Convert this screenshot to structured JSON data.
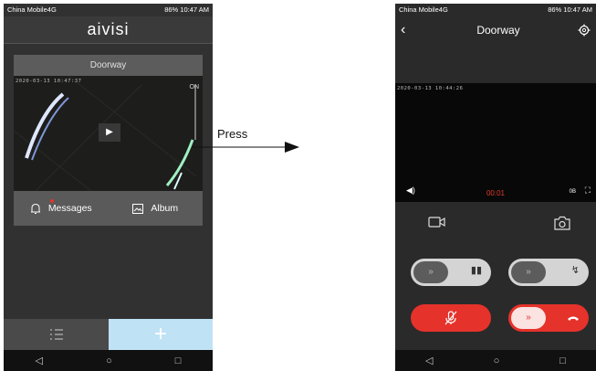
{
  "left_phone": {
    "statusbar": {
      "carrier": "China Mobile4G",
      "battery": "86%",
      "time": "10:47 AM"
    },
    "app_logo": "aivisi",
    "camera": {
      "name": "Doorway",
      "timestamp": "2020-03-13 10:47:37",
      "state": "ON"
    },
    "actions": {
      "messages": "Messages",
      "album": "Album"
    },
    "bottom_tabs": {
      "add_symbol": "+"
    }
  },
  "annotation": {
    "press": "Press"
  },
  "right_phone": {
    "statusbar": {
      "carrier": "China Mobile4G",
      "battery": "86%",
      "time": "10:47 AM"
    },
    "title": "Doorway",
    "video": {
      "timestamp": "2020-03-13 10:44:26",
      "timer": "00:01",
      "speed": "0B"
    },
    "switch_symbol": "»"
  },
  "colors": {
    "accent_red": "#e5322b",
    "add_tab": "#bfe3f5",
    "dark_bg": "#313131"
  }
}
